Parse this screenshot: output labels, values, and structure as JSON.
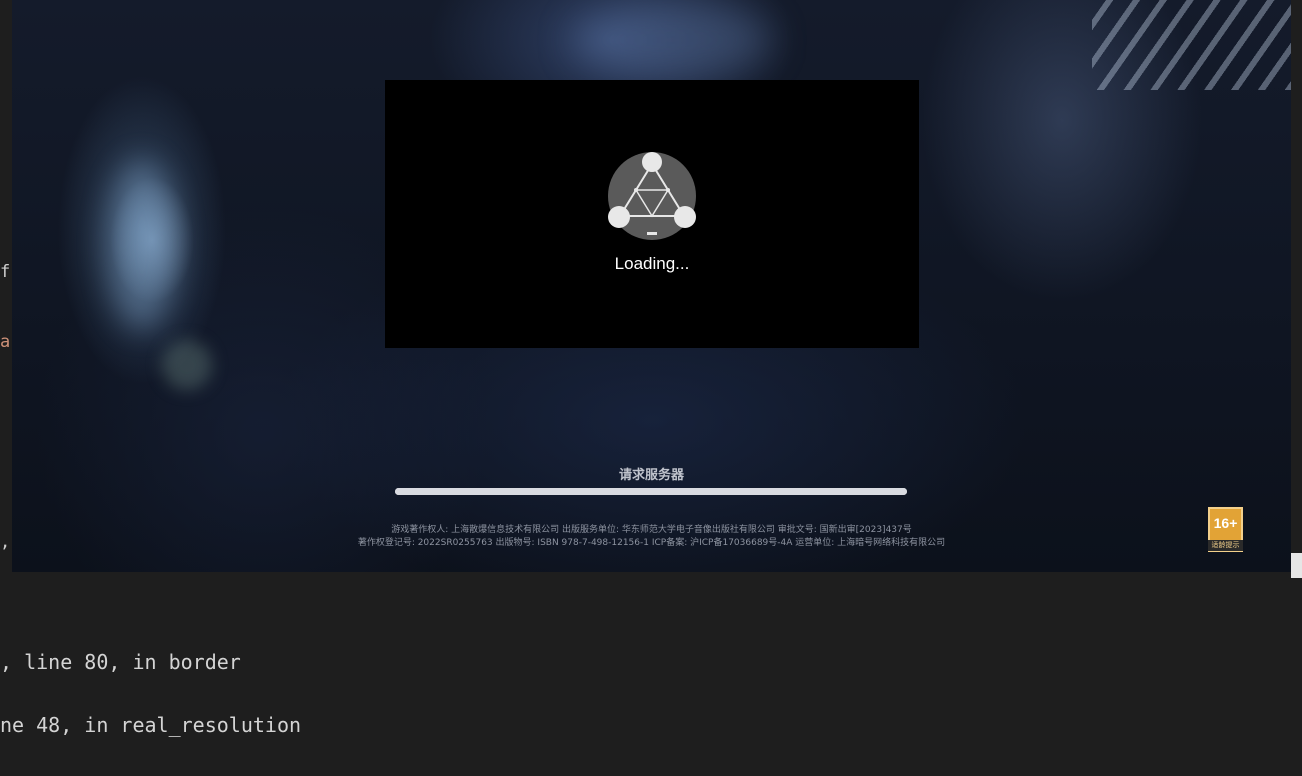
{
  "editor": {
    "edge_fragments": [
      "f",
      "a",
      ","
    ]
  },
  "dialog": {
    "loading_text": "Loading...",
    "logo_icon": "triangle-network-logo-icon"
  },
  "status": {
    "text": "请求服务器",
    "progress": 1.0
  },
  "legal": {
    "line1": "游戏著作权人: 上海散爆信息技术有限公司  出版服务单位: 华东师范大学电子音像出版社有限公司  审批文号: 国新出审[2023]437号",
    "line2": "著作权登记号: 2022SR0255763 出版物号: ISBN 978-7-498-12156-1 ICP备案: 沪ICP备17036689号-4A 运营单位: 上海暗号网络科技有限公司"
  },
  "rating": {
    "age": "16+",
    "label": "适龄提示"
  },
  "terminal": {
    "lines": [
      ", line 80, in border",
      "ne 48, in real_resolution"
    ]
  },
  "colors": {
    "dialog_bg": "#000000",
    "progress_bar": "#c9ccd4",
    "rating_bg": "#e2a336",
    "terminal_bg": "#1e1e1e"
  }
}
